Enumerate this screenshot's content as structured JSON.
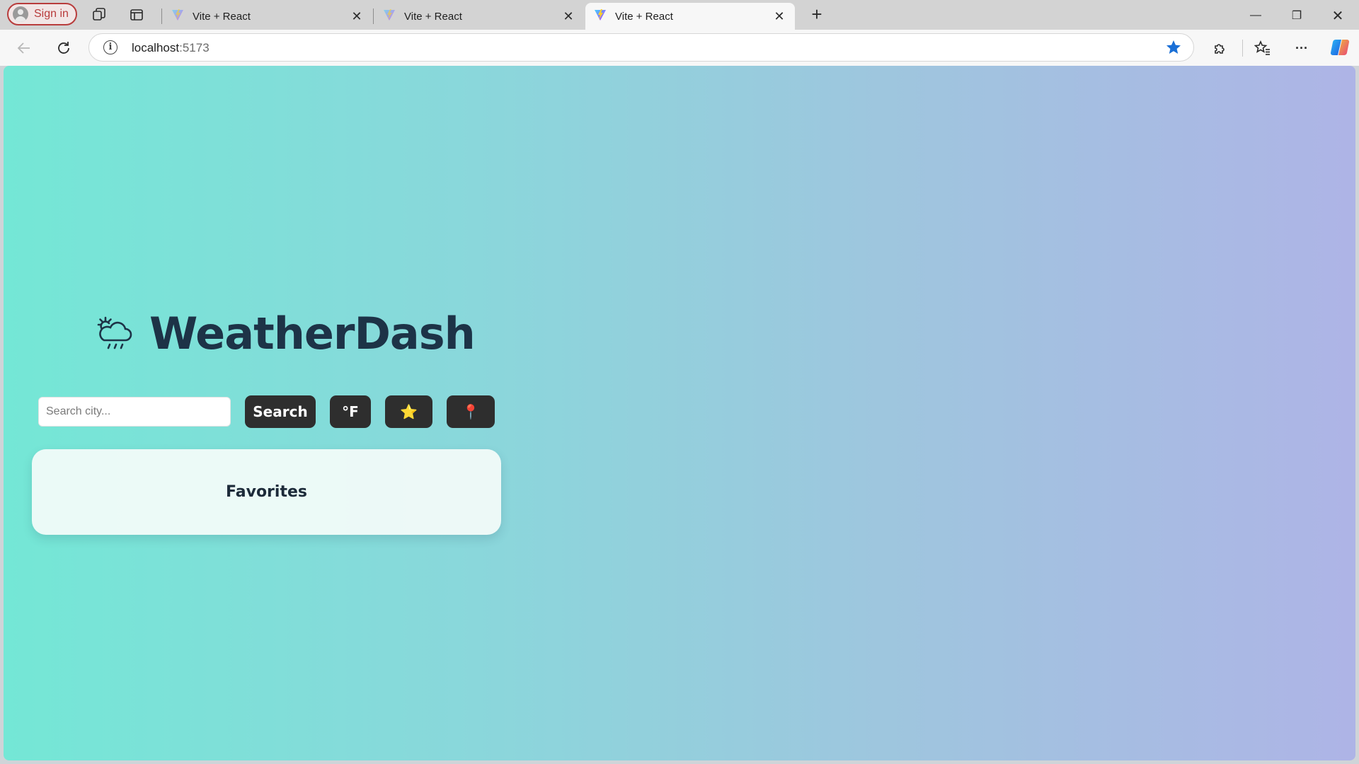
{
  "browser": {
    "signin_label": "Sign in",
    "tabs": [
      {
        "title": "Vite + React",
        "active": false
      },
      {
        "title": "Vite + React",
        "active": false
      },
      {
        "title": "Vite + React",
        "active": true
      }
    ],
    "tab_close_glyph": "✕",
    "new_tab_glyph": "+",
    "address": {
      "host": "localhost",
      "port": ":5173"
    },
    "window_controls": {
      "minimize": "—",
      "restore": "❐",
      "close": "✕"
    },
    "more_glyph": "···"
  },
  "app": {
    "title": "WeatherDash",
    "logo_icon": "cloud-sun-rain-icon",
    "search": {
      "placeholder": "Search city...",
      "value": "",
      "button_label": "Search"
    },
    "unit_toggle_label": "°F",
    "favorite_glyph": "⭐",
    "location_glyph": "📍",
    "favorites_card": {
      "title": "Favorites"
    }
  },
  "colors": {
    "gradient_start": "#74e7d6",
    "gradient_end": "#aeb4e6",
    "button_bg": "#2e2e2e",
    "title_color": "#1d3347",
    "bookmark_star": "#1a6fd6"
  }
}
